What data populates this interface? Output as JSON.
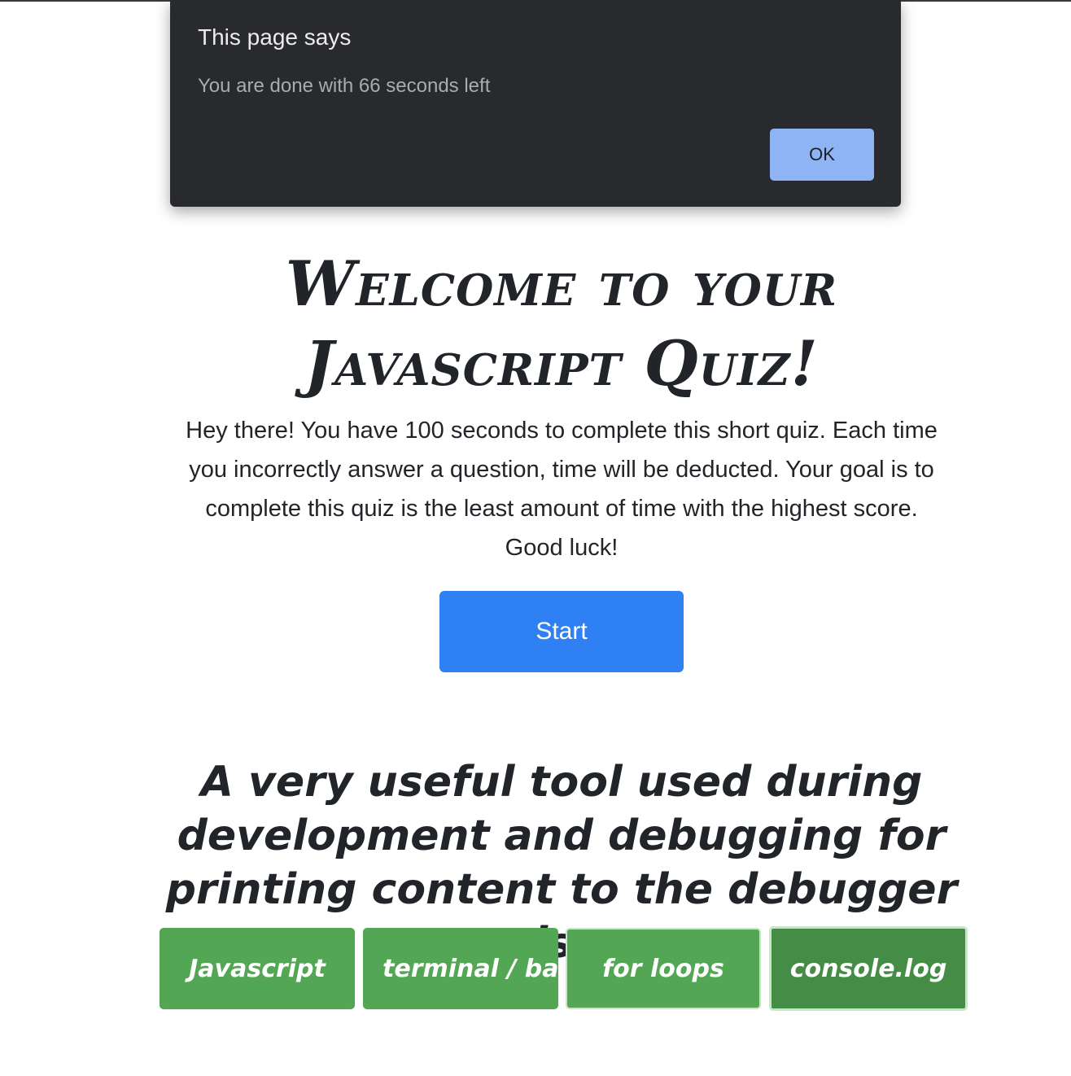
{
  "dialog": {
    "title": "This page says",
    "message": "You are done with 66 seconds left",
    "ok_label": "OK"
  },
  "main": {
    "title_line1": "Welcome to your",
    "title_line2": "Javascript Quiz!",
    "intro": "Hey there! You have 100 seconds to complete this short quiz. Each time you incorrectly answer a question, time will be deducted. Your goal is to complete this quiz is the least amount of time with the highest score. Good luck!",
    "start_label": "Start"
  },
  "quiz": {
    "question": "A very useful tool used during development and debugging for printing content to the debugger is:",
    "answers": [
      "Javascript",
      "terminal / bash",
      "for loops",
      "console.log"
    ]
  },
  "colors": {
    "primary_button": "#2f80f3",
    "answer_button": "#53a653",
    "answer_button_active": "#458d47",
    "dialog_background": "#292a2e",
    "dialog_ok_button": "#8eb4f5"
  }
}
